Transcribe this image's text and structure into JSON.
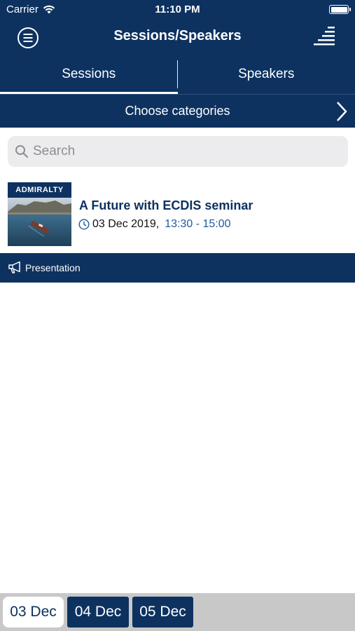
{
  "status_bar": {
    "carrier": "Carrier",
    "time": "11:10 PM"
  },
  "header": {
    "title": "Sessions/Speakers"
  },
  "tabs": [
    {
      "label": "Sessions",
      "active": true
    },
    {
      "label": "Speakers",
      "active": false
    }
  ],
  "categories": {
    "label": "Choose categories"
  },
  "search": {
    "placeholder": "Search",
    "value": ""
  },
  "sessions": [
    {
      "thumbnail_banner": "ADMIRALTY",
      "title": "A Future with ECDIS seminar",
      "date": "03 Dec 2019,",
      "time": "13:30 - 15:00",
      "type": "Presentation"
    }
  ],
  "date_tabs": [
    {
      "label": "03 Dec",
      "selected": true
    },
    {
      "label": "04 Dec",
      "selected": false
    },
    {
      "label": "05 Dec",
      "selected": false
    }
  ],
  "colors": {
    "brand": "#0d3260",
    "accent_time": "#1f5a98",
    "date_bar": "#c8c8c8"
  }
}
